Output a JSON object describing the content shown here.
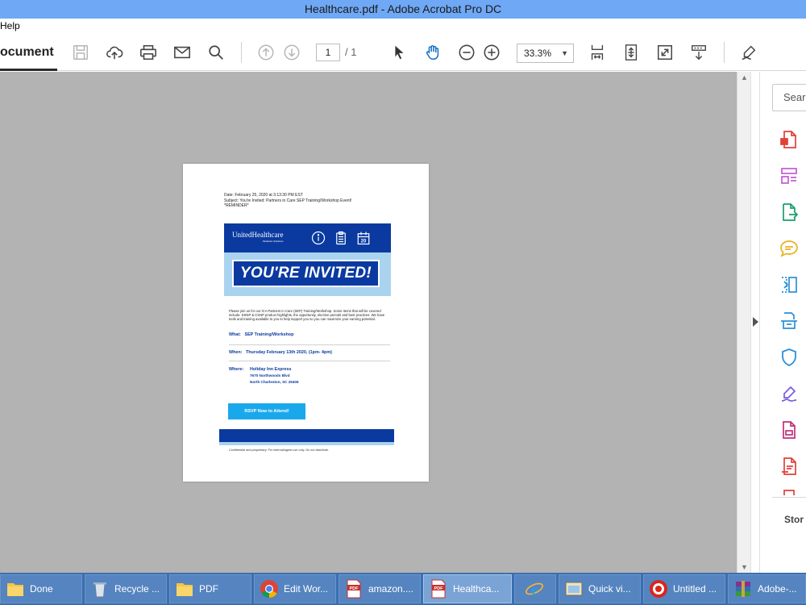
{
  "window": {
    "title": "Healthcare.pdf - Adobe Acrobat Pro DC"
  },
  "menu": {
    "help": "Help"
  },
  "toolbar": {
    "document_tab": "ocument",
    "page_current": "1",
    "page_total": "/ 1",
    "zoom": "33.3%"
  },
  "pdf": {
    "header_line1": "Date: February 25, 2020 at 3:13:30 PM EST",
    "header_line2": "Subject: You're Invited: Partners in Care SEP Training/Workshop Event!",
    "header_line3": "*REMINDER*",
    "logo": "UnitedHealthcare",
    "logo_sub": "Medicare Solutions",
    "calendar_day": "20",
    "invite_heading": "YOU'RE INVITED!",
    "invite_text": "Please join us for our ICA Partners in Care (SEP) Training/Workshop. Some items that will be covered include: DSNP & CSNP product highlights, the opportunity, election periods and best practices. We have tools and training available to you to help support you so you can maximize your earning potential.",
    "what_label": "What:",
    "what_value": "SEP Training/Workshop",
    "when_label": "When:",
    "when_value": "Thursday February 13th 2020, (1pm- 4pm)",
    "where_label": "Where:",
    "where_line1": "Holiday Inn Express",
    "where_line2": "7670 Northwoods Blvd",
    "where_line3": "North Charleston, SC 29406",
    "rsvp_button": "RSVP Now to Attend!",
    "footer_note": "Confidential and proprietary. For internal/agent use only. Do not distribute."
  },
  "tools_pane": {
    "search_placeholder": "Searc",
    "store_label": "Stor"
  },
  "taskbar": {
    "items": [
      {
        "label": "Done"
      },
      {
        "label": "Recycle ..."
      },
      {
        "label": "PDF"
      },
      {
        "label": "Edit Wor..."
      },
      {
        "label": "amazon...."
      },
      {
        "label": "Healthca..."
      },
      {
        "label": ""
      },
      {
        "label": "Quick vi..."
      },
      {
        "label": "Untitled ..."
      },
      {
        "label": "Adobe-..."
      }
    ]
  }
}
